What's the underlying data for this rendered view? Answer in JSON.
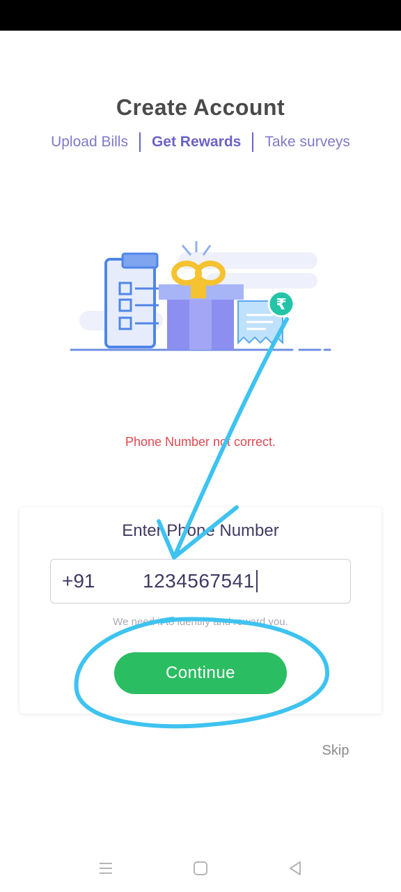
{
  "header": {
    "title": "Create Account",
    "taglines": [
      "Upload Bills",
      "Get Rewards",
      "Take surveys"
    ]
  },
  "illustration": {
    "icons": [
      "clipboard-checklist-icon",
      "gift-box-icon",
      "receipt-icon",
      "rupee-coin-icon"
    ],
    "coin_symbol": "₹"
  },
  "error": {
    "message": "Phone Number not correct."
  },
  "phone_form": {
    "heading": "Enter Phone Number",
    "country_code": "+91",
    "phone_value": "1234567541",
    "helper": "We need it to identify and reward you.",
    "continue_label": "Continue"
  },
  "skip_label": "Skip",
  "nav": {
    "icons": [
      "menu-icon",
      "home-icon",
      "back-icon"
    ]
  },
  "colors": {
    "accent_purple": "#6a63c6",
    "button_green": "#2bbd62",
    "error_red": "#e0484f",
    "annotation_blue": "#3ec3f0"
  }
}
